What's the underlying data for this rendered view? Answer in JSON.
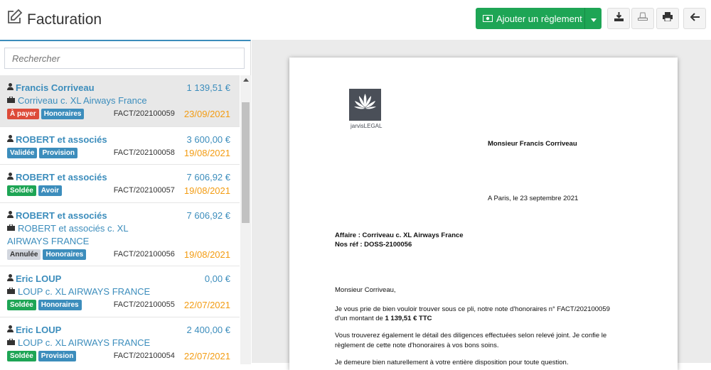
{
  "header": {
    "title": "Facturation",
    "add_payment_label": "Ajouter un règlement"
  },
  "search": {
    "placeholder": "Rechercher"
  },
  "invoices": [
    {
      "client": "Francis Corriveau",
      "amount": "1 139,51 €",
      "affair": "Corriveau c. XL Airways France",
      "affair2": "",
      "badges": [
        "À payer",
        "Honoraires"
      ],
      "ref": "FACT/202100059",
      "date": "23/09/2021"
    },
    {
      "client": "ROBERT et associés",
      "amount": "3 600,00 €",
      "affair": "",
      "affair2": "",
      "badges": [
        "Validée",
        "Provision"
      ],
      "ref": "FACT/202100058",
      "date": "19/08/2021"
    },
    {
      "client": "ROBERT et associés",
      "amount": "7 606,92 €",
      "affair": "",
      "affair2": "",
      "badges": [
        "Soldée",
        "Avoir"
      ],
      "ref": "FACT/202100057",
      "date": "19/08/2021"
    },
    {
      "client": "ROBERT et associés",
      "amount": "7 606,92 €",
      "affair": "ROBERT et associés c. XL",
      "affair2": "AIRWAYS FRANCE",
      "badges": [
        "Annulée",
        "Honoraires"
      ],
      "ref": "FACT/202100056",
      "date": "19/08/2021"
    },
    {
      "client": "Eric LOUP",
      "amount": "0,00 €",
      "affair": "LOUP c. XL AIRWAYS FRANCE",
      "affair2": "",
      "badges": [
        "Soldée",
        "Honoraires"
      ],
      "ref": "FACT/202100055",
      "date": "22/07/2021"
    },
    {
      "client": "Eric LOUP",
      "amount": "2 400,00 €",
      "affair": "LOUP c. XL AIRWAYS FRANCE",
      "affair2": "",
      "badges": [
        "Soldée",
        "Provision"
      ],
      "ref": "FACT/202100054",
      "date": "22/07/2021"
    }
  ],
  "document": {
    "logo_text": "jarvisLEGAL",
    "recipient": "Monsieur Francis Corriveau",
    "place_date": "A Paris, le 23 septembre 2021",
    "affair_line": "Affaire : Corriveau c. XL Airways France",
    "ref_line": "Nos réf : DOSS-2100056",
    "salutation": "Monsieur Corriveau,",
    "p1_line1": "Je vous prie de bien vouloir trouver sous ce pli, notre note d'honoraires n° FACT/202100059",
    "p1_line2_prefix": "d'un montant de ",
    "p1_line2_amount": "1 139,51 € TTC",
    "p2_line1": "Vous trouverez également le détail des diligences effectuées selon relevé joint. Je confie le",
    "p2_line2": "règlement de cette note d'honoraires à vos bons soins.",
    "p3_line1": "Je demeure bien naturellement à votre entière disposition pour toute question."
  },
  "colors": {
    "accent": "#3c8dbc",
    "green": "#1ea555",
    "red": "#dd4b39",
    "orange": "#f39c12"
  }
}
